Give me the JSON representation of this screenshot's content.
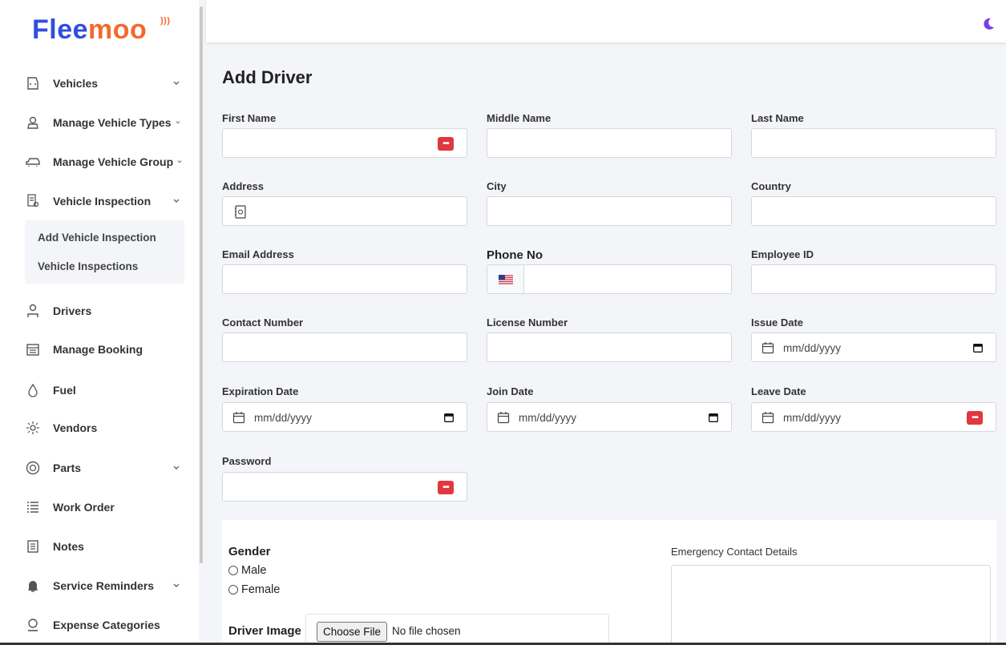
{
  "brand": {
    "logo_main": "Flee",
    "logo_accent": "moo"
  },
  "sidebar": {
    "items": [
      {
        "label": "Vehicles",
        "icon": "car-front-icon",
        "chevron": true
      },
      {
        "label": "Manage Vehicle Types",
        "icon": "car-settings-icon",
        "chevron": true
      },
      {
        "label": "Manage Vehicle Group",
        "icon": "car-group-icon",
        "chevron": true
      },
      {
        "label": "Vehicle Inspection",
        "icon": "inspection-icon",
        "chevron": true
      },
      {
        "label": "Drivers",
        "icon": "driver-icon",
        "chevron": false
      },
      {
        "label": "Manage Booking",
        "icon": "calendar-icon",
        "chevron": false
      },
      {
        "label": "Fuel",
        "icon": "fuel-drop-icon",
        "chevron": false
      },
      {
        "label": "Vendors",
        "icon": "vendors-icon",
        "chevron": false
      },
      {
        "label": "Parts",
        "icon": "tire-icon",
        "chevron": true
      },
      {
        "label": "Work Order",
        "icon": "list-icon",
        "chevron": false
      },
      {
        "label": "Notes",
        "icon": "notes-icon",
        "chevron": false
      },
      {
        "label": "Service Reminders",
        "icon": "bell-icon",
        "chevron": true
      },
      {
        "label": "Expense Categories",
        "icon": "expense-icon",
        "chevron": false
      }
    ],
    "submenu": [
      "Add Vehicle Inspection",
      "Vehicle Inspections"
    ]
  },
  "topbar": {
    "theme_icon": "moon-icon"
  },
  "form": {
    "title": "Add Driver",
    "first_name": "First Name",
    "middle_name": "Middle Name",
    "last_name": "Last Name",
    "address": "Address",
    "city": "City",
    "country": "Country",
    "email": "Email Address",
    "phone": "Phone No",
    "employee_id": "Employee ID",
    "contact_number": "Contact Number",
    "license_number": "License Number",
    "issue_date": "Issue Date",
    "expiration_date": "Expiration Date",
    "join_date": "Join Date",
    "leave_date": "Leave Date",
    "password": "Password",
    "date_placeholder": "mm/dd/yyyy",
    "password_badge": "•••"
  },
  "extra": {
    "gender_title": "Gender",
    "gender_options": [
      "Male",
      "Female"
    ],
    "driver_image_label": "Driver Image",
    "choose_file": "Choose File",
    "no_file": "No file chosen",
    "emergency_label": "Emergency Contact Details"
  },
  "colors": {
    "brand_blue": "#2f4fe0",
    "brand_orange": "#f26a2e",
    "badge_red": "#e0383e",
    "moon_purple": "#7b3fe4"
  }
}
